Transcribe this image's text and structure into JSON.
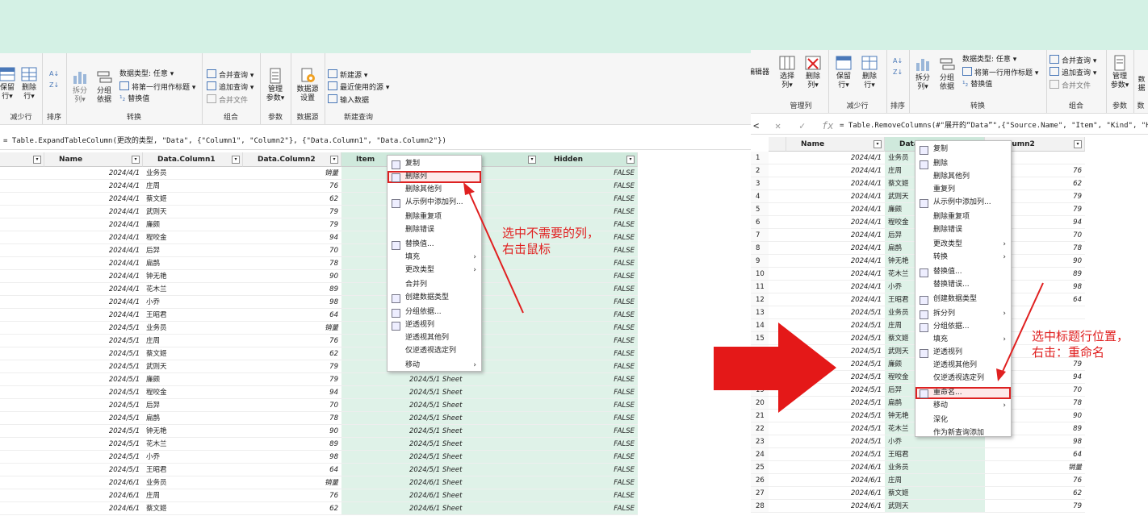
{
  "left": {
    "ribbon": {
      "groups": {
        "reduce_rows": "减少行",
        "sort": "排序",
        "transform": "转换",
        "combine": "组合",
        "params": "参数",
        "datasource": "数据源",
        "new_query": "新建查询"
      },
      "buttons": {
        "keep_rows": "保留\n行▾",
        "remove_rows": "删除\n行▾",
        "split_col": "拆分\n列▾",
        "group_by": "分组\n依据",
        "data_type": "数据类型: 任意 ▾",
        "first_row_header": "将第一行用作标题 ▾",
        "replace_values": "替换值",
        "merge_queries": "合并查询 ▾",
        "append_queries": "追加查询 ▾",
        "combine_files": "合并文件",
        "manage_params": "管理\n参数▾",
        "datasource_settings": "数据源\n设置",
        "new_source": "新建源 ▾",
        "recent_sources": "最近使用的源 ▾",
        "enter_data": "输入数据"
      }
    },
    "formula": "= Table.ExpandTableColumn(更改的类型, \"Data\", {\"Column1\", \"Column2\"}, {\"Data.Column1\", \"Data.Column2\"})",
    "columns": [
      "Name",
      "Data.Column1",
      "Data.Column2",
      "Item",
      "Hidden"
    ],
    "rows": [
      {
        "name": "2024/4/1",
        "c1": "业务员",
        "c2": "销量",
        "item": "",
        "hidden": "FALSE"
      },
      {
        "name": "2024/4/1",
        "c1": "庄周",
        "c2": "76",
        "item": "",
        "hidden": "FALSE"
      },
      {
        "name": "2024/4/1",
        "c1": "蔡文姬",
        "c2": "62",
        "item": "",
        "hidden": "FALSE"
      },
      {
        "name": "2024/4/1",
        "c1": "武则天",
        "c2": "79",
        "item": "",
        "hidden": "FALSE"
      },
      {
        "name": "2024/4/1",
        "c1": "廉颇",
        "c2": "79",
        "item": "",
        "hidden": "FALSE"
      },
      {
        "name": "2024/4/1",
        "c1": "程咬金",
        "c2": "94",
        "item": "",
        "hidden": "FALSE"
      },
      {
        "name": "2024/4/1",
        "c1": "后羿",
        "c2": "70",
        "item": "",
        "hidden": "FALSE"
      },
      {
        "name": "2024/4/1",
        "c1": "扁鹊",
        "c2": "78",
        "item": "",
        "hidden": "FALSE"
      },
      {
        "name": "2024/4/1",
        "c1": "钟无艳",
        "c2": "90",
        "item": "",
        "hidden": "FALSE"
      },
      {
        "name": "2024/4/1",
        "c1": "花木兰",
        "c2": "89",
        "item": "",
        "hidden": "FALSE"
      },
      {
        "name": "2024/4/1",
        "c1": "小乔",
        "c2": "98",
        "item": "",
        "hidden": "FALSE"
      },
      {
        "name": "2024/4/1",
        "c1": "王昭君",
        "c2": "64",
        "item": "",
        "hidden": "FALSE"
      },
      {
        "name": "2024/5/1",
        "c1": "业务员",
        "c2": "销量",
        "item": "",
        "hidden": "FALSE"
      },
      {
        "name": "2024/5/1",
        "c1": "庄周",
        "c2": "76",
        "item": "",
        "hidden": "FALSE"
      },
      {
        "name": "2024/5/1",
        "c1": "蔡文姬",
        "c2": "62",
        "item": "",
        "hidden": "FALSE"
      },
      {
        "name": "2024/5/1",
        "c1": "武则天",
        "c2": "79",
        "item": "",
        "hidden": "FALSE"
      },
      {
        "name": "2024/5/1",
        "c1": "廉颇",
        "c2": "79",
        "item": "2024/5/1  Sheet",
        "hidden": "FALSE"
      },
      {
        "name": "2024/5/1",
        "c1": "程咬金",
        "c2": "94",
        "item": "2024/5/1  Sheet",
        "hidden": "FALSE"
      },
      {
        "name": "2024/5/1",
        "c1": "后羿",
        "c2": "70",
        "item": "2024/5/1  Sheet",
        "hidden": "FALSE"
      },
      {
        "name": "2024/5/1",
        "c1": "扁鹊",
        "c2": "78",
        "item": "2024/5/1  Sheet",
        "hidden": "FALSE"
      },
      {
        "name": "2024/5/1",
        "c1": "钟无艳",
        "c2": "90",
        "item": "2024/5/1  Sheet",
        "hidden": "FALSE"
      },
      {
        "name": "2024/5/1",
        "c1": "花木兰",
        "c2": "89",
        "item": "2024/5/1  Sheet",
        "hidden": "FALSE"
      },
      {
        "name": "2024/5/1",
        "c1": "小乔",
        "c2": "98",
        "item": "2024/5/1  Sheet",
        "hidden": "FALSE"
      },
      {
        "name": "2024/5/1",
        "c1": "王昭君",
        "c2": "64",
        "item": "2024/5/1  Sheet",
        "hidden": "FALSE"
      },
      {
        "name": "2024/6/1",
        "c1": "业务员",
        "c2": "销量",
        "item": "2024/6/1  Sheet",
        "hidden": "FALSE"
      },
      {
        "name": "2024/6/1",
        "c1": "庄周",
        "c2": "76",
        "item": "2024/6/1  Sheet",
        "hidden": "FALSE"
      },
      {
        "name": "2024/6/1",
        "c1": "蔡文姬",
        "c2": "62",
        "item": "2024/6/1  Sheet",
        "hidden": "FALSE"
      }
    ],
    "menu": [
      "复制",
      "删除列",
      "删除其他列",
      "从示例中添加列...",
      "删除重复项",
      "删除错误",
      "替换值...",
      "填充",
      "更改类型",
      "合并列",
      "创建数据类型",
      "分组依据...",
      "逆透视列",
      "逆透视其他列",
      "仅逆透视选定列",
      "移动"
    ],
    "annotation": "选中不需要的列，\n右击鼠标"
  },
  "right": {
    "ribbon": {
      "groups": {
        "manage_cols": "管理列",
        "reduce_rows": "减少行",
        "sort": "排序",
        "transform": "转换",
        "combine": "组合",
        "params": "参数",
        "datasource": "数"
      },
      "buttons": {
        "editor": "编辑器",
        "choose_cols": "选择\n列▾",
        "remove_cols": "删除\n列▾",
        "keep_rows": "保留\n行▾",
        "remove_rows": "删除\n行▾",
        "split_col": "拆分\n列▾",
        "group_by": "分组\n依据",
        "data_type": "数据类型: 任意 ▾",
        "first_row_header": "将第一行用作标题 ▾",
        "replace_values": "替换值",
        "merge_queries": "合并查询 ▾",
        "append_queries": "追加查询 ▾",
        "combine_files": "合并文件",
        "manage_params": "管理\n参数▾",
        "datasource_cut": "数据"
      }
    },
    "formula": "= Table.RemoveColumns(#\"展开的“Data”\",{\"Source.Name\", \"Item\", \"Kind\", \"Hidd",
    "columns": [
      "Name",
      "Data",
      "a.Column2"
    ],
    "rows": [
      {
        "n": "1",
        "name": "2024/4/1",
        "c1": "业务员",
        "c2": ""
      },
      {
        "n": "2",
        "name": "2024/4/1",
        "c1": "庄周",
        "c2": "76"
      },
      {
        "n": "3",
        "name": "2024/4/1",
        "c1": "蔡文姬",
        "c2": "62"
      },
      {
        "n": "4",
        "name": "2024/4/1",
        "c1": "武则天",
        "c2": "79"
      },
      {
        "n": "5",
        "name": "2024/4/1",
        "c1": "廉颇",
        "c2": "79"
      },
      {
        "n": "6",
        "name": "2024/4/1",
        "c1": "程咬金",
        "c2": "94"
      },
      {
        "n": "7",
        "name": "2024/4/1",
        "c1": "后羿",
        "c2": "70"
      },
      {
        "n": "8",
        "name": "2024/4/1",
        "c1": "扁鹊",
        "c2": "78"
      },
      {
        "n": "9",
        "name": "2024/4/1",
        "c1": "钟无艳",
        "c2": "90"
      },
      {
        "n": "10",
        "name": "2024/4/1",
        "c1": "花木兰",
        "c2": "89"
      },
      {
        "n": "11",
        "name": "2024/4/1",
        "c1": "小乔",
        "c2": "98"
      },
      {
        "n": "12",
        "name": "2024/4/1",
        "c1": "王昭君",
        "c2": "64"
      },
      {
        "n": "13",
        "name": "2024/5/1",
        "c1": "业务员",
        "c2": ""
      },
      {
        "n": "14",
        "name": "2024/5/1",
        "c1": "庄周",
        "c2": ""
      },
      {
        "n": "15",
        "name": "2024/5/1",
        "c1": "蔡文姬",
        "c2": ""
      },
      {
        "n": "16",
        "name": "2024/5/1",
        "c1": "武则天",
        "c2": ""
      },
      {
        "n": "17",
        "name": "2024/5/1",
        "c1": "廉颇",
        "c2": "79"
      },
      {
        "n": "18",
        "name": "2024/5/1",
        "c1": "程咬金",
        "c2": "94"
      },
      {
        "n": "19",
        "name": "2024/5/1",
        "c1": "后羿",
        "c2": "70"
      },
      {
        "n": "20",
        "name": "2024/5/1",
        "c1": "扁鹊",
        "c2": "78"
      },
      {
        "n": "21",
        "name": "2024/5/1",
        "c1": "钟无艳",
        "c2": "90"
      },
      {
        "n": "22",
        "name": "2024/5/1",
        "c1": "花木兰",
        "c2": "89"
      },
      {
        "n": "23",
        "name": "2024/5/1",
        "c1": "小乔",
        "c2": "98"
      },
      {
        "n": "24",
        "name": "2024/5/1",
        "c1": "王昭君",
        "c2": "64"
      },
      {
        "n": "25",
        "name": "2024/6/1",
        "c1": "业务员",
        "c2": "销量"
      },
      {
        "n": "26",
        "name": "2024/6/1",
        "c1": "庄周",
        "c2": "76"
      },
      {
        "n": "27",
        "name": "2024/6/1",
        "c1": "蔡文姬",
        "c2": "62"
      },
      {
        "n": "28",
        "name": "2024/6/1",
        "c1": "武则天",
        "c2": "79"
      }
    ],
    "menu": [
      "复制",
      "删除",
      "删除其他列",
      "重复列",
      "从示例中添加列...",
      "删除重复项",
      "删除错误",
      "更改类型",
      "转换",
      "替换值...",
      "替换错误...",
      "创建数据类型",
      "拆分列",
      "分组依据...",
      "填充",
      "逆透视列",
      "逆透视其他列",
      "仅逆透视选定列",
      "重命名...",
      "移动",
      "深化",
      "作为新查询添加"
    ],
    "annotation": "选中标题行位置，\n右击：重命名"
  },
  "colors": {
    "accent_red": "#e02020",
    "green_sel": "#dff2e8",
    "banner": "#d4f1e5"
  }
}
